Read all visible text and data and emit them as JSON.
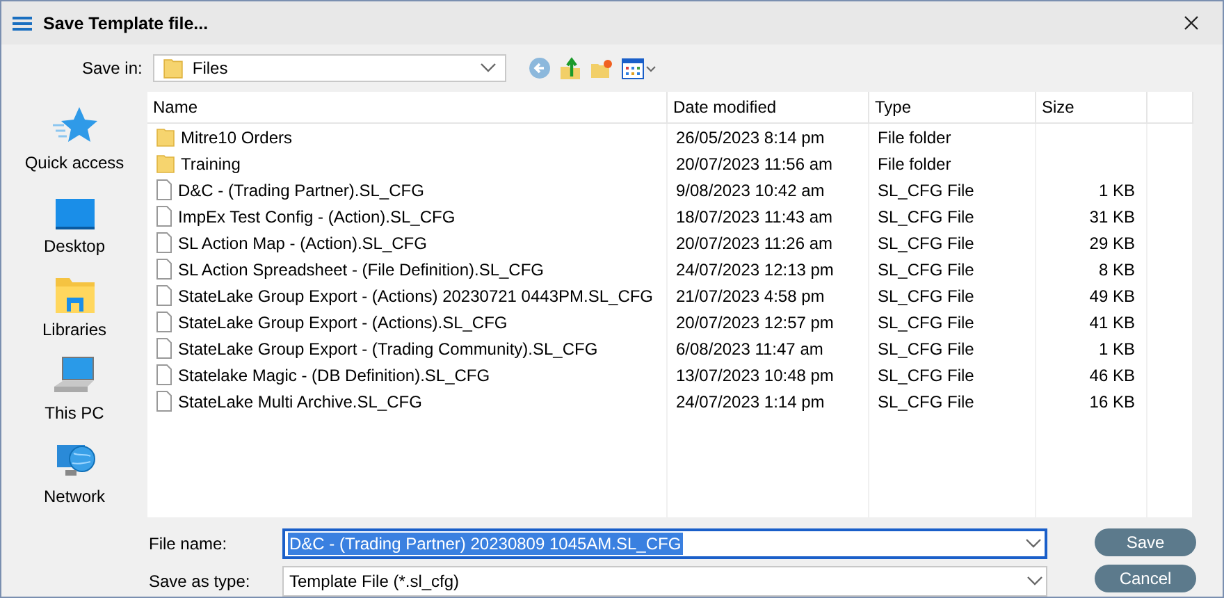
{
  "window": {
    "title": "Save Template file..."
  },
  "save_in": {
    "label": "Save in:",
    "value": "Files"
  },
  "sidebar": {
    "items": [
      {
        "label": "Quick access",
        "kind": "star"
      },
      {
        "label": "Desktop",
        "kind": "desktop"
      },
      {
        "label": "Libraries",
        "kind": "libraries"
      },
      {
        "label": "This PC",
        "kind": "pc"
      },
      {
        "label": "Network",
        "kind": "network"
      }
    ]
  },
  "table": {
    "columns": [
      "Name",
      "Date modified",
      "Type",
      "Size"
    ],
    "rows": [
      {
        "kind": "folder",
        "name": "Mitre10 Orders",
        "date": "26/05/2023 8:14 pm",
        "type": "File folder"
      },
      {
        "kind": "folder",
        "name": "Training",
        "date": "20/07/2023 11:56 am",
        "type": "File folder"
      },
      {
        "kind": "file",
        "name": "D&C - (Trading Partner).SL_CFG",
        "date": "9/08/2023 10:42 am",
        "type": "SL_CFG File",
        "size": "1 KB"
      },
      {
        "kind": "file",
        "name": "ImpEx Test Config - (Action).SL_CFG",
        "date": "18/07/2023 11:43 am",
        "type": "SL_CFG File",
        "size": "31 KB"
      },
      {
        "kind": "file",
        "name": "SL Action Map - (Action).SL_CFG",
        "date": "20/07/2023 11:26 am",
        "type": "SL_CFG File",
        "size": "29 KB"
      },
      {
        "kind": "file",
        "name": "SL Action Spreadsheet - (File Definition).SL_CFG",
        "date": "24/07/2023 12:13 pm",
        "type": "SL_CFG File",
        "size": "8 KB"
      },
      {
        "kind": "file",
        "name": "StateLake Group Export - (Actions) 20230721 0443PM.SL_CFG",
        "date": "21/07/2023 4:58 pm",
        "type": "SL_CFG File",
        "size": "49 KB"
      },
      {
        "kind": "file",
        "name": "StateLake Group Export - (Actions).SL_CFG",
        "date": "20/07/2023 12:57 pm",
        "type": "SL_CFG File",
        "size": "41 KB"
      },
      {
        "kind": "file",
        "name": "StateLake Group Export - (Trading Community).SL_CFG",
        "date": "6/08/2023 11:47 am",
        "type": "SL_CFG File",
        "size": "1 KB"
      },
      {
        "kind": "file",
        "name": "Statelake Magic - (DB Definition).SL_CFG",
        "date": "13/07/2023 10:48 pm",
        "type": "SL_CFG File",
        "size": "46 KB"
      },
      {
        "kind": "file",
        "name": "StateLake Multi Archive.SL_CFG",
        "date": "24/07/2023 1:14 pm",
        "type": "SL_CFG File",
        "size": "16 KB"
      }
    ]
  },
  "file_name": {
    "label": "File name:",
    "value": "D&C - (Trading Partner) 20230809 1045AM.SL_CFG",
    "text_selected": true
  },
  "save_as_type": {
    "label": "Save as type:",
    "value": "Template File (*.sl_cfg)"
  },
  "buttons": [
    "Save",
    "Cancel"
  ]
}
